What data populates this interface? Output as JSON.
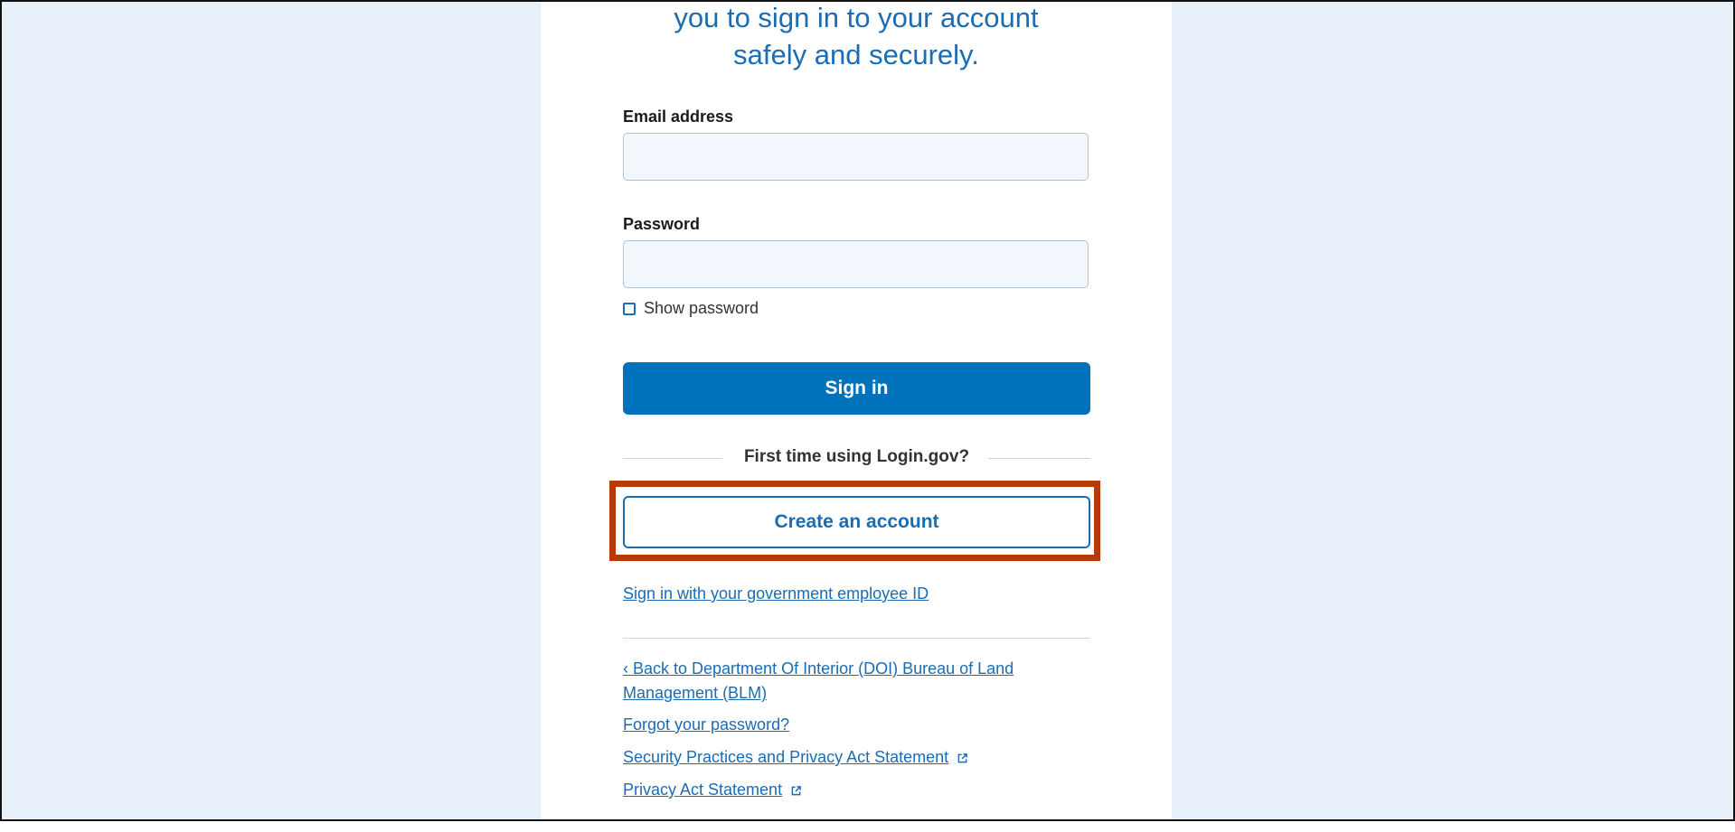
{
  "intro": {
    "line1": "you to sign in to your account",
    "line2": "safely and securely."
  },
  "form": {
    "email_label": "Email address",
    "email_value": "",
    "password_label": "Password",
    "password_value": "",
    "show_password_label": "Show password",
    "sign_in_label": "Sign in"
  },
  "signup": {
    "divider_text": "First time using Login.gov?",
    "create_account_label": "Create an account"
  },
  "links": {
    "gov_employee": "Sign in with your government employee ID",
    "back_line1": "‹ Back to Department Of Interior (DOI) Bureau of Land",
    "back_line2": "Management (BLM)",
    "forgot_password": "Forgot your password?",
    "security_practices": "Security Practices and Privacy Act Statement",
    "privacy_act": "Privacy Act Statement"
  },
  "colors": {
    "accent": "#0071bb",
    "link": "#1a6cb5",
    "highlight": "#b73a0c",
    "page_bg": "#e8f1f9"
  },
  "icons": {
    "external_link": "external-link-icon"
  }
}
